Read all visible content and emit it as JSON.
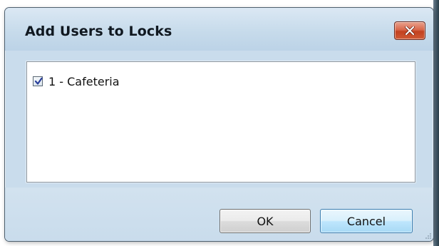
{
  "dialog": {
    "title": "Add Users to Locks",
    "close_icon": "close-x-icon"
  },
  "list": {
    "items": [
      {
        "label": "1 - Cafeteria",
        "checked": true
      }
    ]
  },
  "buttons": {
    "ok_label": "OK",
    "cancel_label": "Cancel"
  },
  "colors": {
    "window_frame": "#c9dcec",
    "close_button": "#c2411f",
    "focused_button_border": "#3c7fb1"
  }
}
